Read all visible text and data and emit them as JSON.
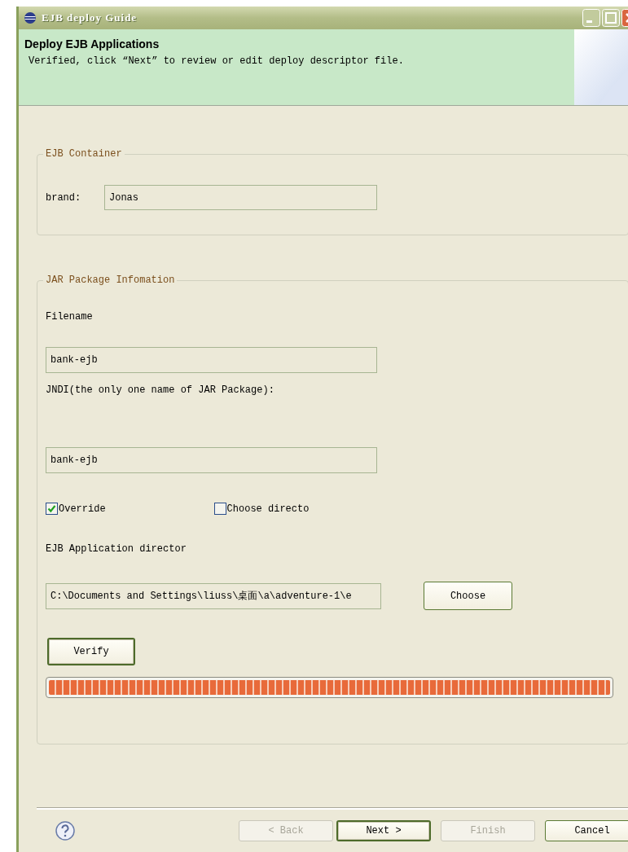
{
  "window": {
    "title": "EJB deploy Guide"
  },
  "banner": {
    "title": "Deploy EJB Applications",
    "message": "Verified, click “Next” to review or edit deploy descriptor file."
  },
  "container_group": {
    "legend": "EJB Container",
    "label": "brand:",
    "value": "Jonas"
  },
  "jar_group": {
    "legend": "JAR Package Infomation",
    "filename_label": "Filename",
    "filename_value": "bank-ejb",
    "jndi_label": "JNDI(the only one name of JAR Package):",
    "jndi_value": "bank-ejb",
    "checkboxes": [
      {
        "label": "Override",
        "checked": true
      },
      {
        "label": "Choose directo",
        "checked": false
      }
    ],
    "directory_label": "EJB  Application director",
    "directory_value": "C:\\Documents and Settings\\liuss\\桌面\\a\\adventure-1\\e",
    "choose_button": "Choose",
    "verify_button": {
      "label": "Verify",
      "focused": true
    },
    "progress": {
      "level": 1
    }
  },
  "footer": {
    "buttons": [
      {
        "label": "< Back",
        "disabled": true,
        "default": false
      },
      {
        "label": "Next >",
        "disabled": false,
        "default": true
      },
      {
        "label": "Finish",
        "disabled": true,
        "default": false
      },
      {
        "label": "Cancel",
        "disabled": false,
        "default": false
      }
    ]
  }
}
